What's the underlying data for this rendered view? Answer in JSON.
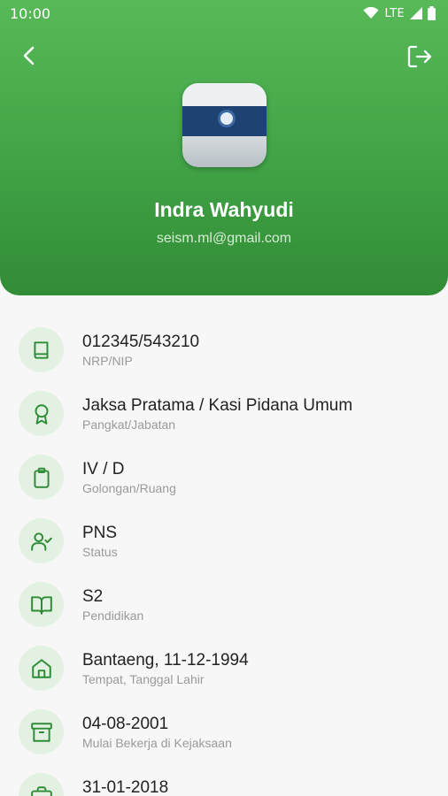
{
  "status_bar": {
    "time": "10:00",
    "network": "LTE"
  },
  "header": {
    "name": "Indra Wahyudi",
    "email": "seism.ml@gmail.com"
  },
  "colors": {
    "primary": "#43a547",
    "icon_bg": "#e3f1e3",
    "icon_stroke": "#2e8b36"
  },
  "items": [
    {
      "icon": "book-icon",
      "value": "012345/543210",
      "label": "NRP/NIP"
    },
    {
      "icon": "award-icon",
      "value": "Jaksa Pratama / Kasi Pidana Umum",
      "label": "Pangkat/Jabatan"
    },
    {
      "icon": "clipboard-icon",
      "value": "IV / D",
      "label": "Golongan/Ruang"
    },
    {
      "icon": "user-check-icon",
      "value": "PNS",
      "label": "Status"
    },
    {
      "icon": "book-open-icon",
      "value": "S2",
      "label": "Pendidikan"
    },
    {
      "icon": "home-icon",
      "value": "Bantaeng, 11-12-1994",
      "label": "Tempat, Tanggal Lahir"
    },
    {
      "icon": "archive-icon",
      "value": "04-08-2001",
      "label": "Mulai Bekerja di Kejaksaan"
    },
    {
      "icon": "briefcase-icon",
      "value": "31-01-2018",
      "label": ""
    }
  ]
}
